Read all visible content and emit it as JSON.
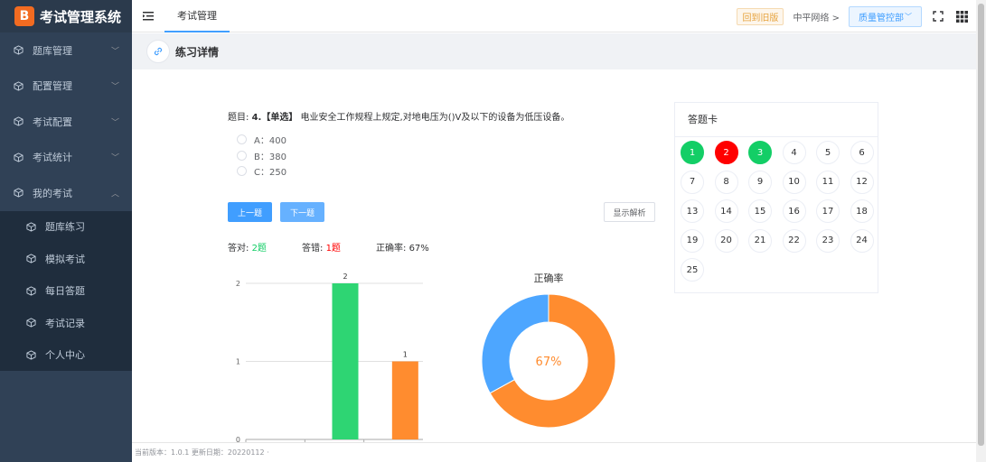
{
  "app": {
    "logo_char": "B",
    "title": "考试管理系统"
  },
  "sidebar": {
    "items": [
      {
        "label": "题库管理",
        "expanded": false
      },
      {
        "label": "配置管理",
        "expanded": false
      },
      {
        "label": "考试配置",
        "expanded": false
      },
      {
        "label": "考试统计",
        "expanded": false
      },
      {
        "label": "我的考试",
        "expanded": true
      }
    ],
    "subitems": [
      {
        "label": "题库练习"
      },
      {
        "label": "模拟考试"
      },
      {
        "label": "每日答题"
      },
      {
        "label": "考试记录"
      },
      {
        "label": "个人中心"
      }
    ]
  },
  "topbar": {
    "tab": "考试管理",
    "old_version": "回到旧版",
    "network": "中平网络 >",
    "dept": "质量管控部"
  },
  "page": {
    "title": "练习详情"
  },
  "question": {
    "prefix": "题目:",
    "number": "4.",
    "type": "【单选】",
    "text": "电业安全工作规程上规定,对地电压为()V及以下的设备为低压设备。",
    "options": [
      "A：400",
      "B：380",
      "C：250"
    ]
  },
  "buttons": {
    "prev": "上一题",
    "next": "下一题",
    "explain": "显示解析"
  },
  "stats": {
    "correct_label": "答对:",
    "correct_value": "2题",
    "wrong_label": "答错:",
    "wrong_value": "1题",
    "rate_label": "正确率:",
    "rate_value": "67%"
  },
  "answer_card": {
    "title": "答题卡",
    "questions": [
      {
        "n": "1",
        "status": "correct"
      },
      {
        "n": "2",
        "status": "wrong"
      },
      {
        "n": "3",
        "status": "correct"
      },
      {
        "n": "4",
        "status": "none"
      },
      {
        "n": "5",
        "status": "none"
      },
      {
        "n": "6",
        "status": "none"
      },
      {
        "n": "7",
        "status": "none"
      },
      {
        "n": "8",
        "status": "none"
      },
      {
        "n": "9",
        "status": "none"
      },
      {
        "n": "10",
        "status": "none"
      },
      {
        "n": "11",
        "status": "none"
      },
      {
        "n": "12",
        "status": "none"
      },
      {
        "n": "13",
        "status": "none"
      },
      {
        "n": "14",
        "status": "none"
      },
      {
        "n": "15",
        "status": "none"
      },
      {
        "n": "16",
        "status": "none"
      },
      {
        "n": "17",
        "status": "none"
      },
      {
        "n": "18",
        "status": "none"
      },
      {
        "n": "19",
        "status": "none"
      },
      {
        "n": "20",
        "status": "none"
      },
      {
        "n": "21",
        "status": "none"
      },
      {
        "n": "22",
        "status": "none"
      },
      {
        "n": "23",
        "status": "none"
      },
      {
        "n": "24",
        "status": "none"
      },
      {
        "n": "25",
        "status": "none"
      }
    ]
  },
  "footer": {
    "text": "当前版本：1.0.1 更新日期：20220112 ·"
  },
  "colors": {
    "correct": "#2ed573",
    "wrong": "#ff8c2f",
    "donut_blue": "#4da6ff",
    "donut_orange": "#ff8c2f"
  },
  "chart_data": [
    {
      "type": "bar",
      "categories": [
        "",
        "",
        ""
      ],
      "values": [
        0,
        2,
        1
      ],
      "colors": [
        "#2ed573",
        "#2ed573",
        "#ff8c2f"
      ],
      "yticks": [
        0,
        1,
        2
      ],
      "ylim": [
        0,
        2
      ],
      "data_labels": [
        "",
        "2",
        "1"
      ]
    },
    {
      "type": "pie",
      "title": "正确率",
      "center_label": "67%",
      "slices": [
        {
          "value": 67,
          "color": "#ff8c2f"
        },
        {
          "value": 33,
          "color": "#4da6ff"
        }
      ]
    }
  ]
}
